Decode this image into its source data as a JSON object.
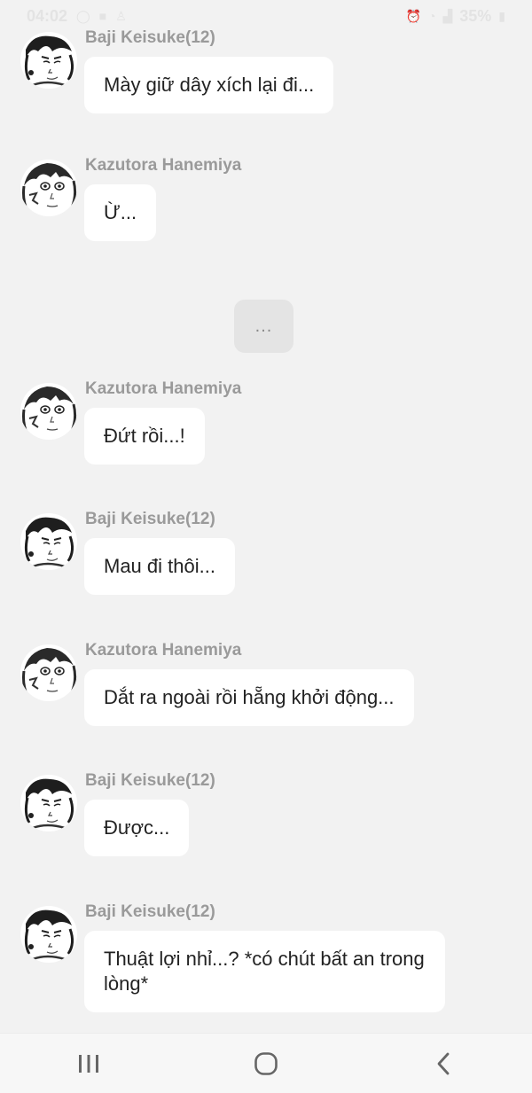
{
  "status_bar": {
    "time": "04:02",
    "battery": "35%",
    "left_icons": [
      "whatsapp-icon",
      "camera-icon",
      "person-icon"
    ],
    "right_icons": [
      "alarm-icon",
      "wifi-icon",
      "signal-icon",
      "battery-icon"
    ]
  },
  "separator": {
    "text": "..."
  },
  "messages": [
    {
      "sender": "Baji Keisuke(12)",
      "text": "Mày giữ dây xích lại đi...",
      "avatar": "baji-avatar"
    },
    {
      "sender": "Kazutora Hanemiya",
      "text": "Ừ...",
      "avatar": "kazutora-avatar"
    },
    {
      "sender": "Kazutora Hanemiya",
      "text": "Đứt rồi...!",
      "avatar": "kazutora-avatar"
    },
    {
      "sender": "Baji Keisuke(12)",
      "text": "Mau đi thôi...",
      "avatar": "baji-avatar"
    },
    {
      "sender": "Kazutora Hanemiya",
      "text": "Dắt ra ngoài rồi hẵng khởi động...",
      "avatar": "kazutora-avatar"
    },
    {
      "sender": "Baji Keisuke(12)",
      "text": "Được...",
      "avatar": "baji-avatar"
    },
    {
      "sender": "Baji Keisuke(12)",
      "text": "Thuật lợi nhỉ...? *có chút bất an trong lòng*",
      "avatar": "baji-avatar"
    }
  ],
  "nav_bar": {
    "icons": [
      "recent-apps-icon",
      "home-icon",
      "back-icon"
    ]
  }
}
